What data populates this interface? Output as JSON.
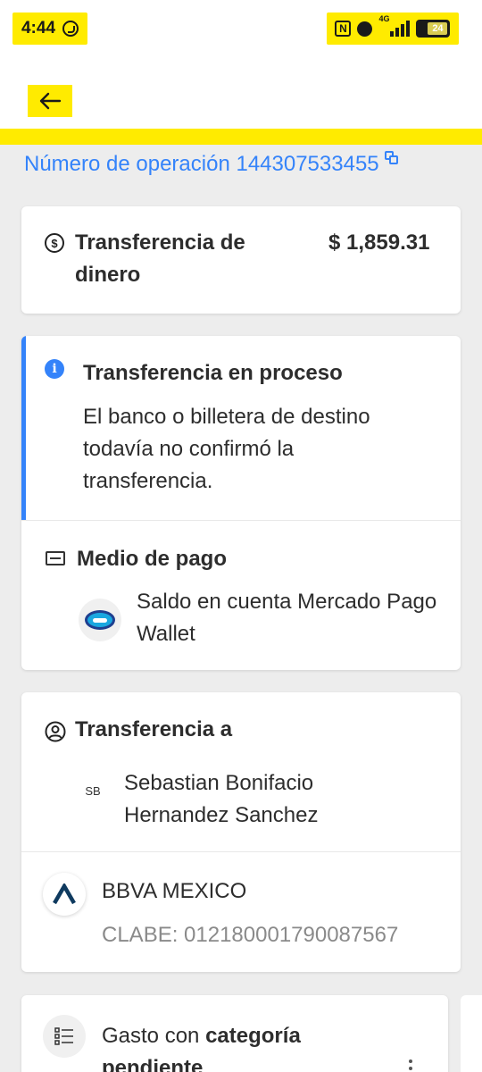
{
  "status_bar": {
    "time": "4:44",
    "network": "4G",
    "battery": "24"
  },
  "header": {
    "back_icon": "arrow-left-icon"
  },
  "operation": {
    "label": "Número de operación 144307533455",
    "copy_icon": "copy-icon"
  },
  "summary": {
    "title": "Transferencia de dinero",
    "amount": "$ 1,859.31",
    "icon": "dollar-circle-icon"
  },
  "status": {
    "title": "Transferencia en proceso",
    "message": "El banco o billetera de destino todavía no confirmó la transferencia.",
    "icon": "info-icon",
    "accent_color": "#3483fa"
  },
  "payment_method": {
    "title": "Medio de pago",
    "method": "Saldo en cuenta Mercado Pago Wallet",
    "icon": "credit-card-icon"
  },
  "recipient": {
    "title": "Transferencia a",
    "initials": "SB",
    "name": "Sebastian Bonifacio Hernandez Sanchez",
    "bank": "BBVA MEXICO",
    "clabe": "CLABE: 012180001790087567"
  },
  "category": {
    "prefix": "Gasto con",
    "bold": "categoría pendiente"
  },
  "colors": {
    "brand_yellow": "#ffeb00",
    "link_blue": "#3483fa",
    "background": "#ededed"
  }
}
